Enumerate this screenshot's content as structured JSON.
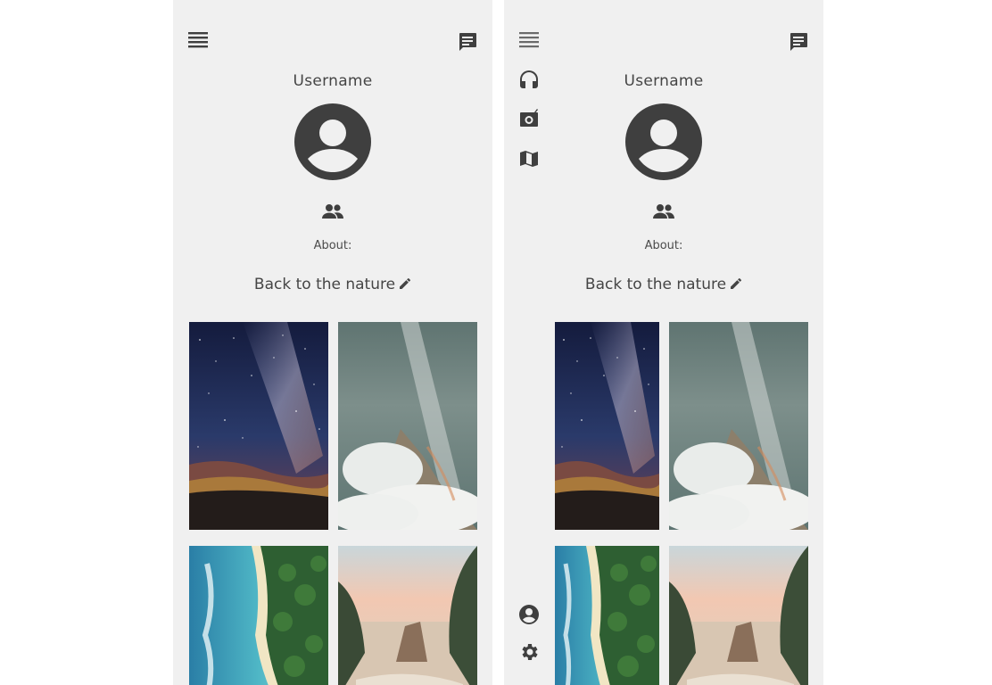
{
  "profile": {
    "username": "Username",
    "about_label": "About:",
    "bio": "Back to the nature"
  },
  "icons": {
    "menu": "menu-icon",
    "chat": "chat-icon",
    "avatar": "account-circle-icon",
    "friends": "people-icon",
    "edit": "pencil-icon",
    "drawer": [
      "headphones-icon",
      "radio-icon",
      "map-icon",
      "account-circle-icon",
      "gear-icon"
    ]
  },
  "photos": [
    "night-sky-milky-way",
    "misty-mountain-peak",
    "aerial-coastline-forest",
    "coastal-sea-rock"
  ],
  "colors": {
    "screen_bg": "#f0f0f0",
    "icon": "#3f3f3f",
    "text": "#454545"
  }
}
